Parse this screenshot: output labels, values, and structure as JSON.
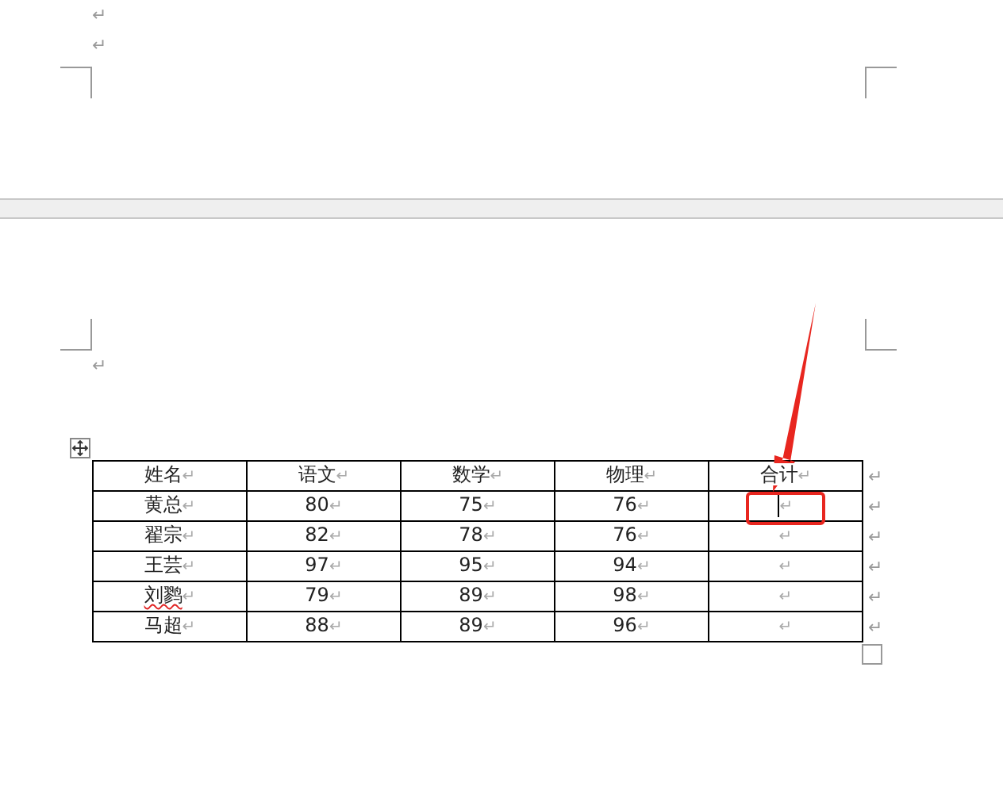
{
  "page_top": {
    "marks": [
      "↵",
      "↵"
    ]
  },
  "page_bottom": {
    "marks": [
      "↵"
    ]
  },
  "table": {
    "columns": [
      {
        "text": "姓名",
        "mark": "↵"
      },
      {
        "text": "语文",
        "mark": "↵"
      },
      {
        "text": "数学",
        "mark": "↵"
      },
      {
        "text": "物理",
        "mark": "↵"
      },
      {
        "text": "合计",
        "mark": "↵"
      }
    ],
    "row_end_mark": "↵",
    "rows": [
      [
        {
          "text": "黄总",
          "mark": "↵"
        },
        {
          "text": "80",
          "mark": "↵"
        },
        {
          "text": "75",
          "mark": "↵"
        },
        {
          "text": "76",
          "mark": "↵"
        },
        {
          "mark": "↵",
          "caret": true
        }
      ],
      [
        {
          "text": "翟宗",
          "mark": "↵"
        },
        {
          "text": "82",
          "mark": "↵"
        },
        {
          "text": "78",
          "mark": "↵"
        },
        {
          "text": "76",
          "mark": "↵"
        },
        {
          "mark": "↵"
        }
      ],
      [
        {
          "text": "王芸",
          "mark": "↵"
        },
        {
          "text": "97",
          "mark": "↵"
        },
        {
          "text": "95",
          "mark": "↵"
        },
        {
          "text": "94",
          "mark": "↵"
        },
        {
          "mark": "↵"
        }
      ],
      [
        {
          "text": "刘鹨",
          "mark": "↵",
          "misspelled": true
        },
        {
          "text": "79",
          "mark": "↵"
        },
        {
          "text": "89",
          "mark": "↵"
        },
        {
          "text": "98",
          "mark": "↵"
        },
        {
          "mark": "↵"
        }
      ],
      [
        {
          "text": "马超",
          "mark": "↵"
        },
        {
          "text": "88",
          "mark": "↵"
        },
        {
          "text": "89",
          "mark": "↵"
        },
        {
          "text": "96",
          "mark": "↵"
        },
        {
          "mark": "↵"
        }
      ]
    ]
  },
  "annotation": {
    "kind": "arrow-box"
  }
}
